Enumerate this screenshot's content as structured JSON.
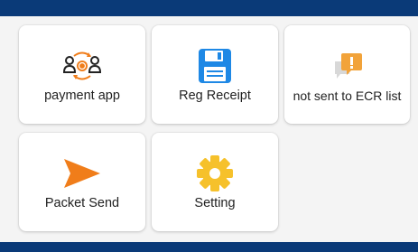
{
  "tiles": [
    {
      "label": "payment app",
      "icon": "payment-exchange-icon"
    },
    {
      "label": "Reg Receipt",
      "icon": "floppy-disk-icon"
    },
    {
      "label": "not sent to ECR list",
      "icon": "chat-alert-icon"
    },
    {
      "label": "Packet Send",
      "icon": "send-arrow-icon"
    },
    {
      "label": "Setting",
      "icon": "gear-icon"
    }
  ],
  "colors": {
    "bar": "#0a3a78",
    "accent_orange": "#f07d1a",
    "floppy_blue": "#1e88e5",
    "gear_yellow": "#f6c12b",
    "alert_orange": "#f2a33a"
  }
}
